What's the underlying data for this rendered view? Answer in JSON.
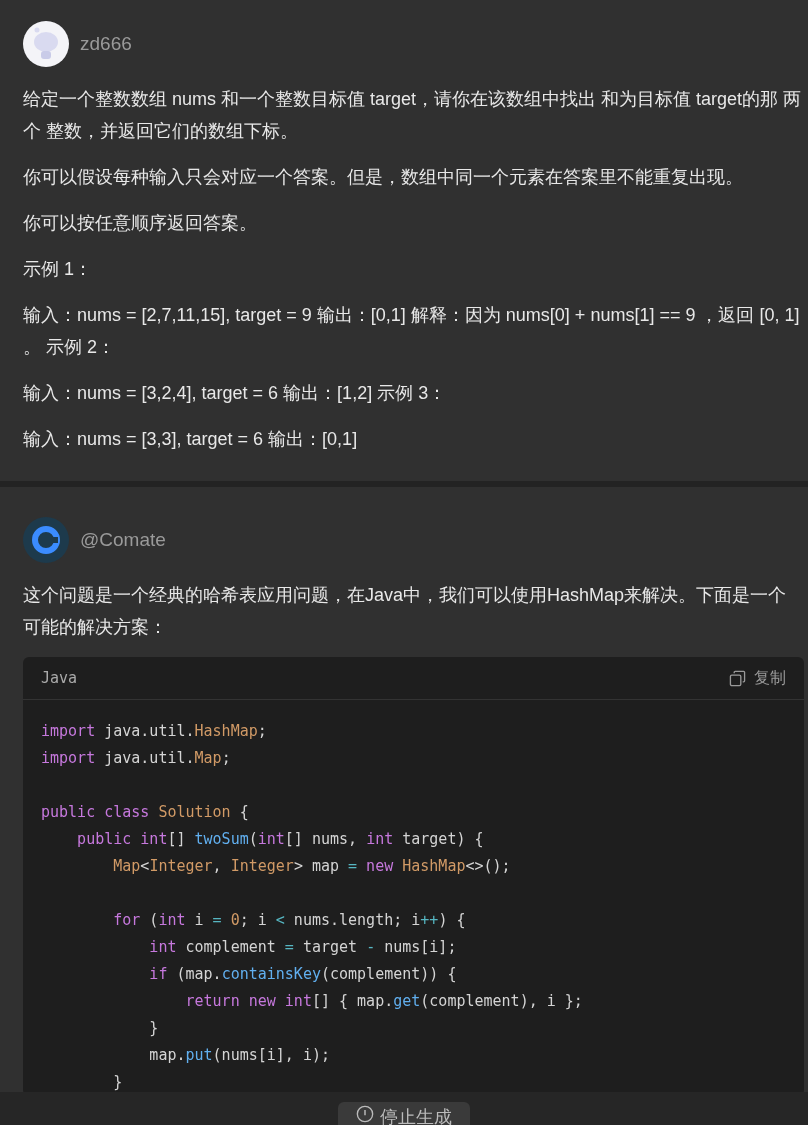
{
  "messages": [
    {
      "kind": "user",
      "author": "zd666",
      "paragraphs": [
        "给定一个整数数组 nums 和一个整数目标值 target，请你在该数组中找出 和为目标值 target的那 两个 整数，并返回它们的数组下标。",
        "你可以假设每种输入只会对应一个答案。但是，数组中同一个元素在答案里不能重复出现。",
        "你可以按任意顺序返回答案。",
        "示例 1：",
        "输入：nums = [2,7,11,15], target = 9 输出：[0,1] 解释：因为 nums[0] + nums[1] == 9 ，返回 [0, 1] 。 示例 2：",
        "输入：nums = [3,2,4], target = 6 输出：[1,2] 示例 3：",
        "输入：nums = [3,3], target = 6 输出：[0,1]"
      ]
    },
    {
      "kind": "assistant",
      "author": "@Comate",
      "paragraphs": [
        "这个问题是一个经典的哈希表应用问题，在Java中，我们可以使用HashMap来解决。下面是一个可能的解决方案："
      ],
      "code": {
        "language": "Java",
        "copy_label": "复制",
        "lines": [
          {
            "kind": "code",
            "tokens": [
              {
                "kind": "kw",
                "text": "import"
              },
              {
                "kind": "plain",
                "text": " java.util."
              },
              {
                "kind": "type",
                "text": "HashMap"
              },
              {
                "kind": "plain",
                "text": ";"
              }
            ]
          },
          {
            "kind": "code",
            "tokens": [
              {
                "kind": "kw",
                "text": "import"
              },
              {
                "kind": "plain",
                "text": " java.util."
              },
              {
                "kind": "type",
                "text": "Map"
              },
              {
                "kind": "plain",
                "text": ";"
              }
            ]
          },
          {
            "kind": "blank"
          },
          {
            "kind": "code",
            "tokens": [
              {
                "kind": "kw",
                "text": "public class"
              },
              {
                "kind": "type",
                "text": " Solution"
              },
              {
                "kind": "plain",
                "text": " {"
              }
            ]
          },
          {
            "kind": "code",
            "tokens": [
              {
                "kind": "kw",
                "text": "    public"
              },
              {
                "kind": "kw",
                "text": " int"
              },
              {
                "kind": "plain",
                "text": "[] "
              },
              {
                "kind": "fn",
                "text": "twoSum"
              },
              {
                "kind": "plain",
                "text": "("
              },
              {
                "kind": "kw",
                "text": "int"
              },
              {
                "kind": "plain",
                "text": "[] nums, "
              },
              {
                "kind": "kw",
                "text": "int"
              },
              {
                "kind": "plain",
                "text": " target) {"
              }
            ]
          },
          {
            "kind": "code",
            "tokens": [
              {
                "kind": "type",
                "text": "        Map"
              },
              {
                "kind": "plain",
                "text": "<"
              },
              {
                "kind": "type",
                "text": "Integer"
              },
              {
                "kind": "plain",
                "text": ", "
              },
              {
                "kind": "type",
                "text": "Integer"
              },
              {
                "kind": "plain",
                "text": "> map "
              },
              {
                "kind": "op",
                "text": "="
              },
              {
                "kind": "kw",
                "text": " new"
              },
              {
                "kind": "type",
                "text": " HashMap"
              },
              {
                "kind": "plain",
                "text": "<>();"
              }
            ]
          },
          {
            "kind": "blank"
          },
          {
            "kind": "code",
            "tokens": [
              {
                "kind": "kw",
                "text": "        for"
              },
              {
                "kind": "plain",
                "text": " ("
              },
              {
                "kind": "kw",
                "text": "int"
              },
              {
                "kind": "plain",
                "text": " i "
              },
              {
                "kind": "op",
                "text": "="
              },
              {
                "kind": "num",
                "text": " 0"
              },
              {
                "kind": "plain",
                "text": "; i "
              },
              {
                "kind": "op",
                "text": "<"
              },
              {
                "kind": "plain",
                "text": " nums.length; i"
              },
              {
                "kind": "op",
                "text": "++"
              },
              {
                "kind": "plain",
                "text": ") {"
              }
            ]
          },
          {
            "kind": "code",
            "tokens": [
              {
                "kind": "kw",
                "text": "            int"
              },
              {
                "kind": "plain",
                "text": " complement "
              },
              {
                "kind": "op",
                "text": "="
              },
              {
                "kind": "plain",
                "text": " target "
              },
              {
                "kind": "op",
                "text": "-"
              },
              {
                "kind": "plain",
                "text": " nums[i];"
              }
            ]
          },
          {
            "kind": "code",
            "tokens": [
              {
                "kind": "kw",
                "text": "            if"
              },
              {
                "kind": "plain",
                "text": " (map."
              },
              {
                "kind": "fn",
                "text": "containsKey"
              },
              {
                "kind": "plain",
                "text": "(complement)) {"
              }
            ]
          },
          {
            "kind": "code",
            "tokens": [
              {
                "kind": "kw",
                "text": "                return"
              },
              {
                "kind": "kw",
                "text": " new"
              },
              {
                "kind": "kw",
                "text": " int"
              },
              {
                "kind": "plain",
                "text": "[] { map."
              },
              {
                "kind": "fn",
                "text": "get"
              },
              {
                "kind": "plain",
                "text": "(complement), i };"
              }
            ]
          },
          {
            "kind": "code",
            "tokens": [
              {
                "kind": "plain",
                "text": "            }"
              }
            ]
          },
          {
            "kind": "code",
            "tokens": [
              {
                "kind": "plain",
                "text": "            map."
              },
              {
                "kind": "fn",
                "text": "put"
              },
              {
                "kind": "plain",
                "text": "(nums[i], i);"
              }
            ]
          },
          {
            "kind": "code",
            "tokens": [
              {
                "kind": "plain",
                "text": "        }"
              }
            ]
          }
        ]
      }
    }
  ],
  "stop_button": "停止生成"
}
